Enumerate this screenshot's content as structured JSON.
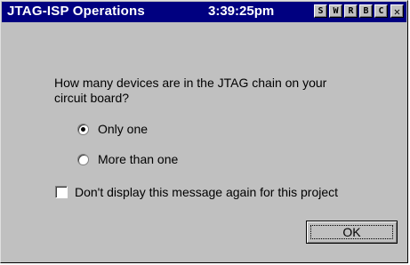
{
  "window": {
    "title": "JTAG-ISP Operations",
    "time": "3:39:25pm",
    "titlebar_buttons": [
      "S",
      "W",
      "R",
      "B",
      "C"
    ],
    "close_glyph": "✕"
  },
  "dialog": {
    "question": "How many devices are in the JTAG chain on your circuit board?",
    "options": [
      {
        "label": "Only one",
        "selected": true
      },
      {
        "label": "More than one",
        "selected": false
      }
    ],
    "dont_display": {
      "label": "Don't display this message again for this project",
      "checked": false
    },
    "ok_label": "OK"
  }
}
